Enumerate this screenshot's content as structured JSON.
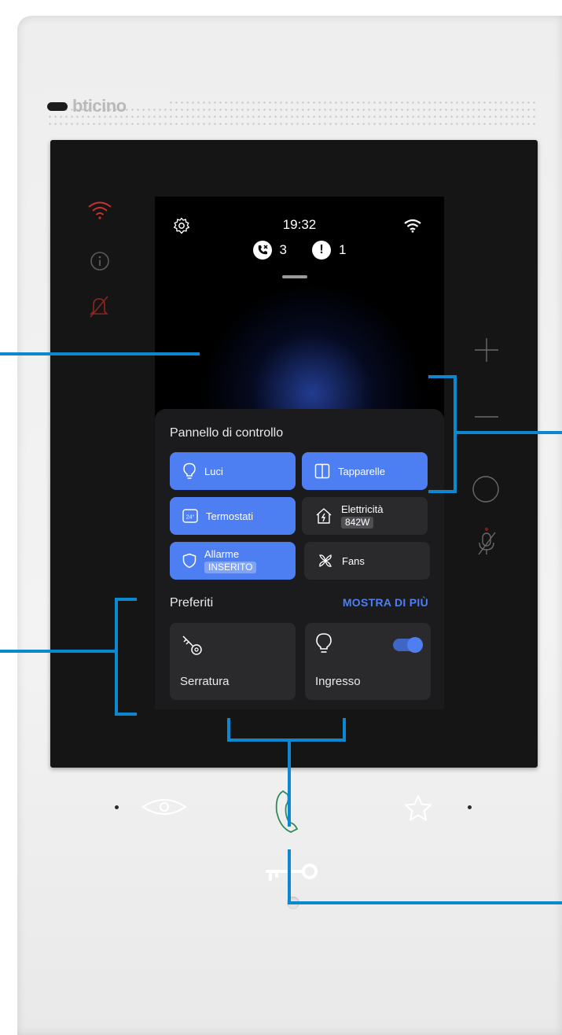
{
  "brand": "bticino",
  "status_bar": {
    "time": "19:32",
    "settings_icon": "gear-icon",
    "wifi_icon": "wifi-icon"
  },
  "notifications": [
    {
      "icon": "missed-call-icon",
      "count": "3"
    },
    {
      "icon": "alert-icon",
      "count": "1"
    }
  ],
  "control_panel": {
    "title": "Pannello di controllo",
    "tiles": [
      {
        "label": "Luci",
        "icon": "lightbulb-icon",
        "state": "on"
      },
      {
        "label": "Tapparelle",
        "icon": "shutter-icon",
        "state": "on"
      },
      {
        "label": "Termostati",
        "icon": "thermostat-icon",
        "state": "on"
      },
      {
        "label": "Elettricità",
        "sub": "842W",
        "icon": "energy-home-icon",
        "state": "off"
      },
      {
        "label": "Allarme",
        "sub": "INSERITO",
        "icon": "shield-icon",
        "state": "on"
      },
      {
        "label": "Fans",
        "icon": "fan-icon",
        "state": "off"
      }
    ]
  },
  "favorites": {
    "title": "Preferiti",
    "more_label": "MOSTRA  DI PIÙ",
    "items": [
      {
        "label": "Serratura",
        "icon": "key-icon"
      },
      {
        "label": "Ingresso",
        "icon": "lightbulb-icon",
        "toggle": true
      }
    ]
  },
  "device_buttons": {
    "left": [
      "wifi-icon",
      "info-icon",
      "mute-bell-icon"
    ],
    "right": [
      "volume-up-icon",
      "volume-down-icon",
      "circle-button-icon",
      "mute-mic-icon"
    ],
    "bottom": [
      "eye-icon",
      "handset-icon",
      "star-icon",
      "key-icon"
    ]
  },
  "colors": {
    "accent": "#4d7ff2",
    "tile_off": "#2a2a2c",
    "callout": "#0b88cf",
    "alert_red": "#c8322d"
  }
}
